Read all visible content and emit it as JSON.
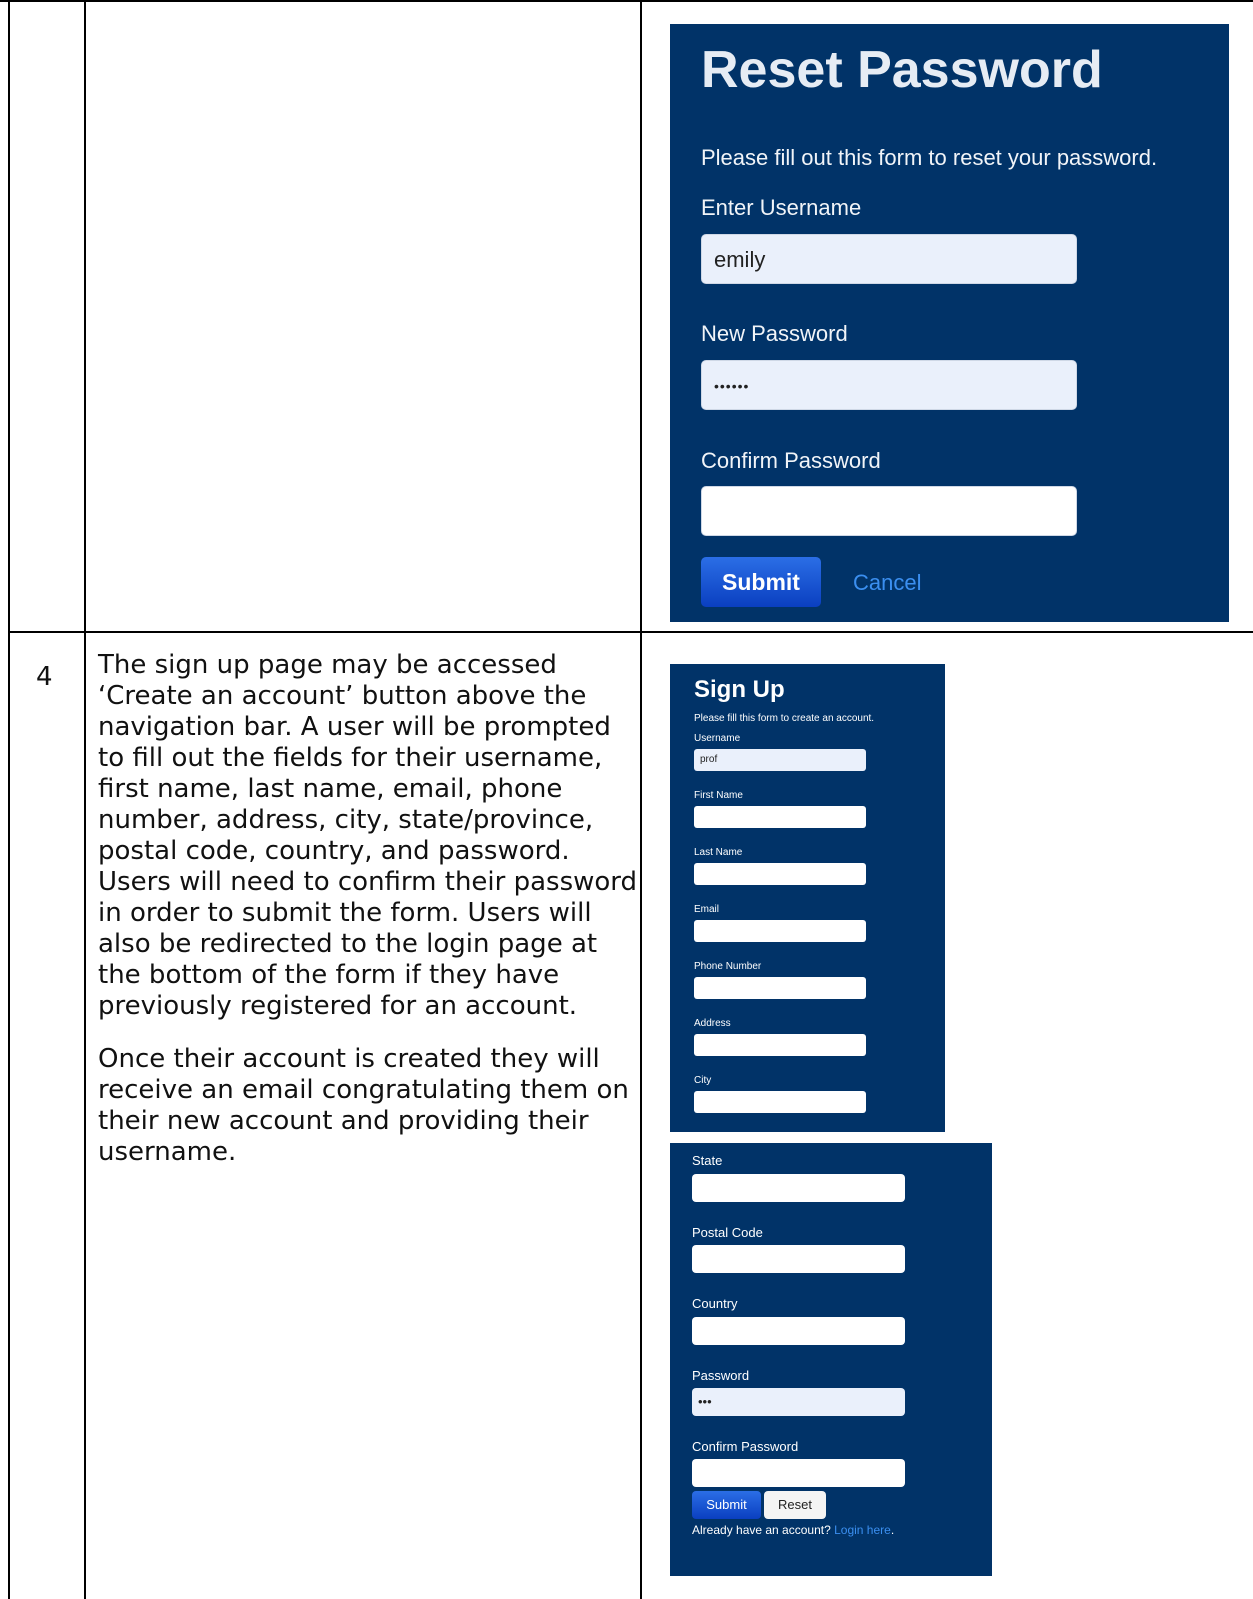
{
  "table": {
    "step_number": "4"
  },
  "description": {
    "paragraph1": "The sign up page may be accessed ‘Create an account’ button above the navigation bar. A user will be prompted to fill out the fields for their username, first name, last name, email, phone number, address, city, state/province, postal code, country, and password. Users will need to confirm their password in order to submit the form. Users will also be redirected to the login page at the bottom of the form if they have previously registered for an account.",
    "paragraph2": "Once their account is created they will receive an email congratulating them on their new account and providing their username."
  },
  "reset_password": {
    "title": "Reset Password",
    "subtitle": "Please fill out this form to reset your password.",
    "username_label": "Enter Username",
    "username_value": "emily",
    "new_password_label": "New Password",
    "new_password_value": "••••••",
    "confirm_password_label": "Confirm Password",
    "confirm_password_value": "",
    "submit_label": "Submit",
    "cancel_label": "Cancel"
  },
  "sign_up": {
    "title": "Sign Up",
    "subtitle": "Please fill this form to create an account.",
    "fields_part1": [
      {
        "label": "Username",
        "value": "prof"
      },
      {
        "label": "First Name",
        "value": ""
      },
      {
        "label": "Last Name",
        "value": ""
      },
      {
        "label": "Email",
        "value": ""
      },
      {
        "label": "Phone Number",
        "value": ""
      },
      {
        "label": "Address",
        "value": ""
      },
      {
        "label": "City",
        "value": ""
      }
    ],
    "fields_part2": [
      {
        "label": "State",
        "value": ""
      },
      {
        "label": "Postal Code",
        "value": ""
      },
      {
        "label": "Country",
        "value": ""
      },
      {
        "label": "Password",
        "value": "•••"
      },
      {
        "label": "Confirm Password",
        "value": ""
      }
    ],
    "submit_label": "Submit",
    "reset_label": "Reset",
    "already_text": "Already have an account?",
    "login_link": "Login here",
    "login_suffix": "."
  },
  "colors": {
    "panel_background": "#013368",
    "button_blue": "#0a3fc0",
    "link_blue": "#3b8ff0"
  }
}
